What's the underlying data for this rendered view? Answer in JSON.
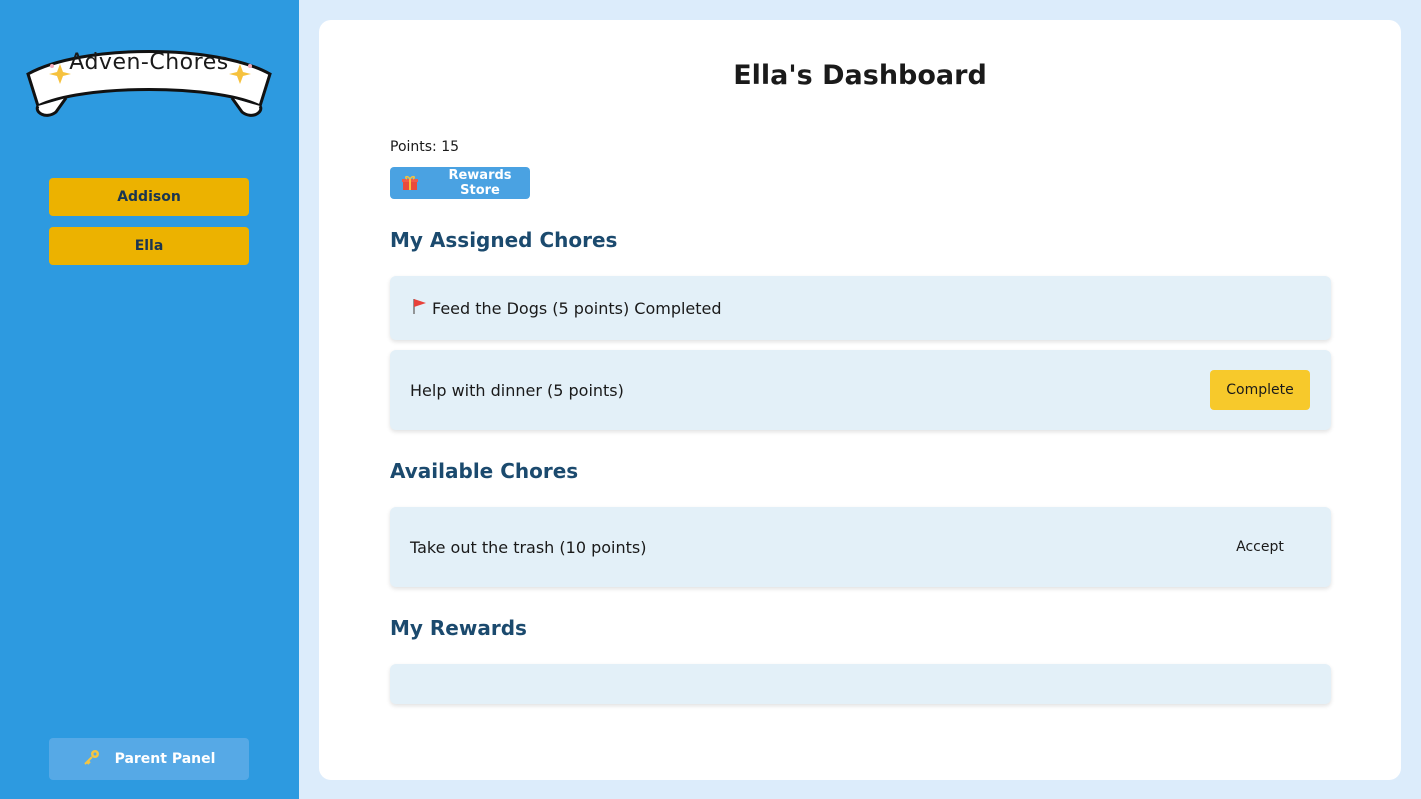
{
  "app": {
    "logo_text": "Adven-Chores"
  },
  "sidebar": {
    "kids": [
      {
        "label": "Addison"
      },
      {
        "label": "Ella"
      }
    ],
    "parent_panel_label": "Parent Panel",
    "parent_panel_icon": "key-icon"
  },
  "main": {
    "title": "Ella's Dashboard",
    "points_text": "Points: 15",
    "rewards_store_label": "Rewards Store",
    "rewards_store_icon": "gift-icon",
    "sections": {
      "assigned": "My Assigned Chores",
      "available": "Available Chores",
      "rewards": "My Rewards"
    },
    "assigned_chores": [
      {
        "text": "Feed the Dogs (5 points) Completed",
        "icon": "flag-icon"
      },
      {
        "text": "Help with dinner (5 points)",
        "action_label": "Complete"
      }
    ],
    "available_chores": [
      {
        "text": "Take out the trash (10 points)",
        "action_label": "Accept"
      }
    ],
    "rewards": []
  },
  "colors": {
    "sidebar_bg": "#2d9ae0",
    "kid_button": "#ecb200",
    "parent_button": "#56a9e6",
    "accent_yellow": "#f7c92b",
    "section_title": "#1b4a6e",
    "card_bg": "#e3f0f8",
    "page_bg": "#dcecfb"
  }
}
